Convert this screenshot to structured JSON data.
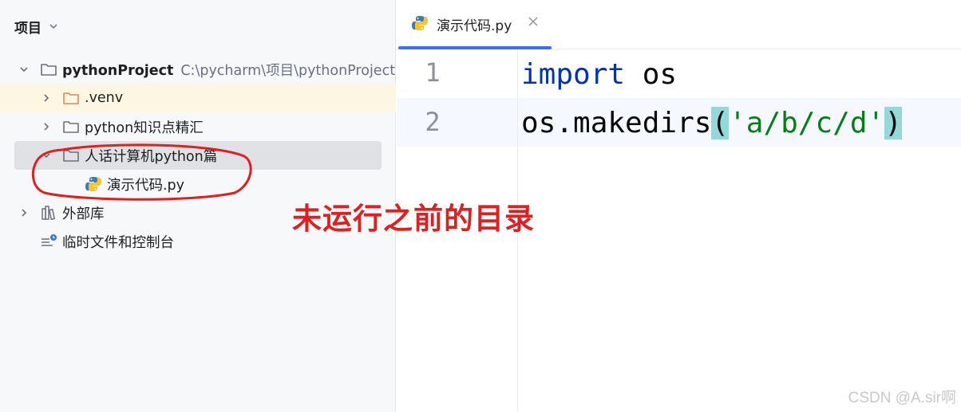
{
  "panel": {
    "title": "项目",
    "tree": [
      {
        "label": "pythonProject",
        "path": "C:\\pycharm\\项目\\pythonProject",
        "expanded": true,
        "icon": "folder-icon"
      },
      {
        "label": ".venv",
        "expanded": false,
        "icon": "folder-orange-icon"
      },
      {
        "label": "python知识点精汇",
        "expanded": false,
        "icon": "folder-icon"
      },
      {
        "label": "人话计算机python篇",
        "expanded": true,
        "icon": "folder-icon"
      },
      {
        "label": "演示代码.py",
        "icon": "python-file-icon"
      },
      {
        "label": "外部库",
        "expanded": false,
        "icon": "library-icon"
      },
      {
        "label": "临时文件和控制台",
        "icon": "scratch-icon"
      }
    ]
  },
  "editor": {
    "tab": {
      "label": "演示代码.py",
      "icon": "python-file-icon",
      "active": true
    },
    "lines": [
      {
        "number": "1",
        "kw": "import",
        "rest": " os"
      },
      {
        "number": "2",
        "pre": "os.makedirs",
        "open": "(",
        "str": "'a/b/c/d'",
        "close": ")"
      }
    ]
  },
  "annotation": {
    "text": "未运行之前的目录",
    "color": "#e02020"
  },
  "watermark": "CSDN @A.sir啊",
  "colors": {
    "accent": "#3574f0",
    "keyword": "#0033b3",
    "string": "#067d17",
    "paren_match": "#93d9d9"
  }
}
